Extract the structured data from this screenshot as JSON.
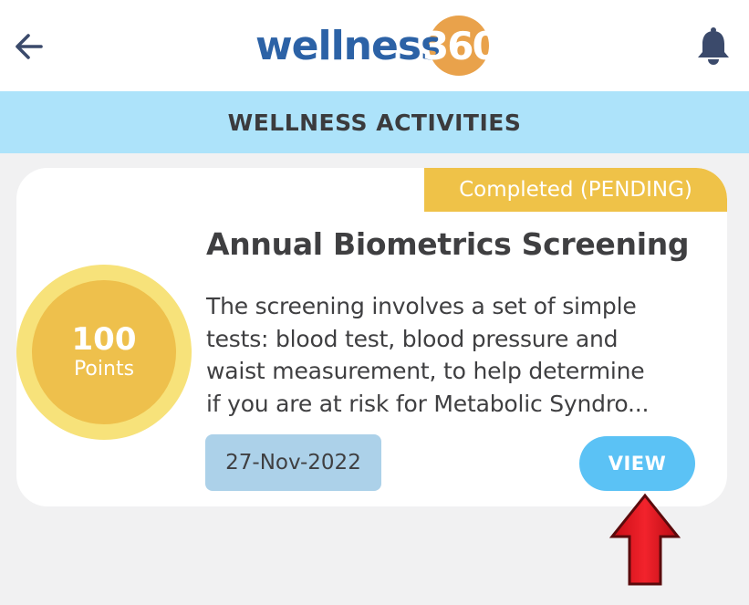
{
  "header": {
    "back_icon": "arrow-left-icon",
    "logo": {
      "text": "wellness",
      "number": "360",
      "text_color": "#2c62a6",
      "circle_color": "#e9a24b"
    },
    "bell_icon": "bell-icon"
  },
  "section": {
    "title": "WELLNESS ACTIVITIES",
    "background": "#ade3fa"
  },
  "activity": {
    "status": "Completed (PENDING)",
    "points_value": "100",
    "points_label": "Points",
    "title": "Annual Biometrics Screening",
    "description_lines": [
      "The screening involves a set of simple",
      "tests: blood test, blood pressure and",
      "waist measurement, to help determine",
      "if you are at risk for Metabolic Syndro..."
    ],
    "date": "27-Nov-2022",
    "view_label": "VIEW"
  },
  "colors": {
    "status_badge": "#efc248",
    "points_outer": "#f7e27a",
    "points_inner": "#eec04c",
    "view_button": "#5bc2f5",
    "date_chip": "#acd1e9",
    "annotation_arrow": "#e0141e"
  },
  "annotation": {
    "icon": "red-arrow-up-icon"
  }
}
